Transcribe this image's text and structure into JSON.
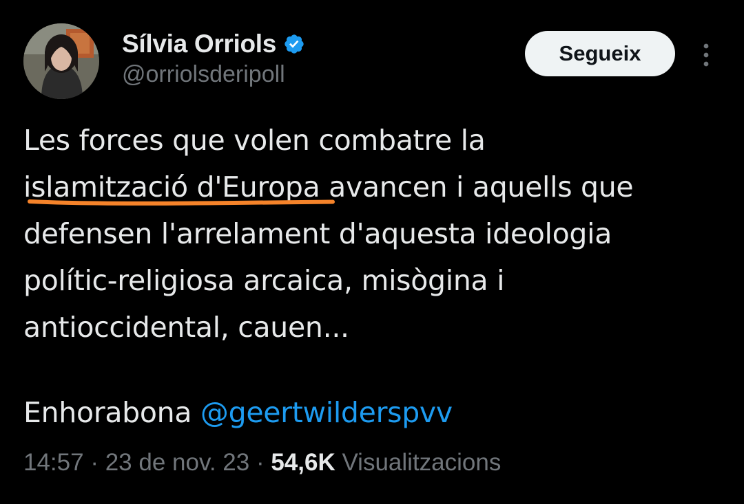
{
  "author": {
    "display_name": "Sílvia Orriols",
    "handle": "@orriolsderipoll",
    "verified": true
  },
  "actions": {
    "follow_label": "Segueix",
    "more_icon": "more-vertical-icon"
  },
  "tweet": {
    "lines": [
      "Les forces que volen combatre la",
      "islamització d'Europa avancen i aquells que",
      "defensen l'arrelament d'aquesta ideologia",
      "polític-religiosa arcaica, misògina i",
      "antioccidental, cauen..."
    ],
    "closing_text": "Enhorabona ",
    "mention": "@geertwilderspvv"
  },
  "meta": {
    "time": "14:57",
    "separator": " · ",
    "date": "23 de nov. 23",
    "views_count": "54,6K",
    "views_label": " Visualitzacions"
  },
  "colors": {
    "background": "#000000",
    "text": "#e7e9ea",
    "secondary": "#71767b",
    "link": "#1d9bf0",
    "verified_badge": "#1d9bf0",
    "highlight_underline": "#f5832a",
    "button_bg": "#eff3f4"
  }
}
